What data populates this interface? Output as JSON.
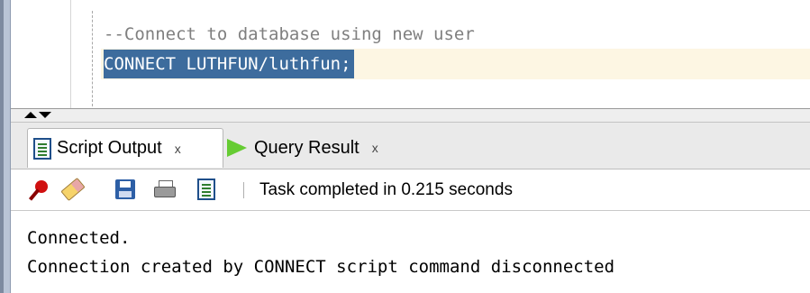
{
  "editor": {
    "lines": [
      "--Connect to database using new user",
      "CONNECT LUTHFUN/luthfun;"
    ]
  },
  "tabs": [
    {
      "label": "Script Output",
      "close": "x",
      "active": true,
      "icon": "script-doc-icon"
    },
    {
      "label": "Query Result",
      "close": "x",
      "active": false,
      "icon": "play-icon"
    }
  ],
  "toolbar": {
    "icons": [
      "pin-icon",
      "eraser-icon",
      "save-icon",
      "print-icon",
      "script-doc-icon"
    ],
    "status": "Task completed in 0.215 seconds"
  },
  "output": {
    "lines": [
      "Connected.",
      "Connection created by CONNECT script command disconnected"
    ]
  },
  "colors": {
    "selection": "#3d6c9d",
    "comment": "#7f7f7f",
    "current_line": "#fdf6e3",
    "play_green": "#66cc33"
  }
}
